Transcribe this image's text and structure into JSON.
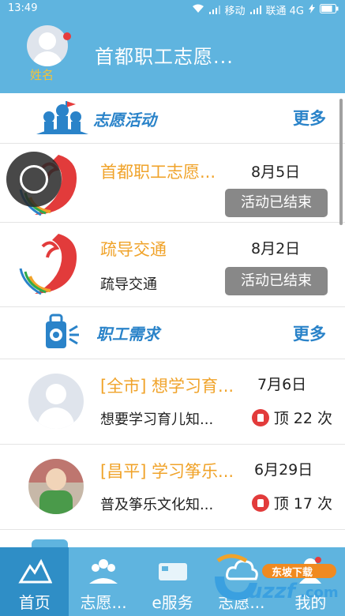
{
  "status_bar": {
    "time": "13:49",
    "carrier1": "移动",
    "carrier2": "联通 4G",
    "battery_percent": 80
  },
  "header": {
    "user_name": "姓名",
    "title": "首都职工志愿..."
  },
  "sections": {
    "volunteer": {
      "title": "志愿活动",
      "more": "更多",
      "items": [
        {
          "title": "首都职工志愿...",
          "date": "8月5日",
          "status": "活动已结束"
        },
        {
          "title": "疏导交通",
          "date": "8月2日",
          "desc": "疏导交通",
          "status": "活动已结束"
        }
      ]
    },
    "needs": {
      "title": "职工需求",
      "more": "更多",
      "items": [
        {
          "title": "[全市] 想学习育...",
          "date": "7月6日",
          "desc": "想要学习育儿知...",
          "likes": "顶 22 次"
        },
        {
          "title": "[昌平] 学习筝乐...",
          "date": "6月29日",
          "desc": "普及筝乐文化知...",
          "likes": "顶 17 次"
        }
      ]
    }
  },
  "bottom_nav": [
    {
      "label": "首页",
      "icon": "home-icon",
      "active": true
    },
    {
      "label": "志愿...",
      "icon": "volunteer-icon",
      "active": false
    },
    {
      "label": "e服务",
      "icon": "card-icon",
      "active": false
    },
    {
      "label": "志愿...",
      "icon": "cloud-icon",
      "active": false
    },
    {
      "label": "我的",
      "icon": "profile-icon",
      "active": false
    }
  ],
  "watermark": {
    "brand": "uzzf",
    "domain": ".com",
    "site": "东坡下载"
  },
  "colors": {
    "primary": "#5fb4df",
    "primary_dark": "#2f8ec6",
    "accent_orange": "#f0a32a",
    "link_blue": "#2a83c9",
    "status_gray": "#888888",
    "badge_red": "#e63d3d"
  }
}
